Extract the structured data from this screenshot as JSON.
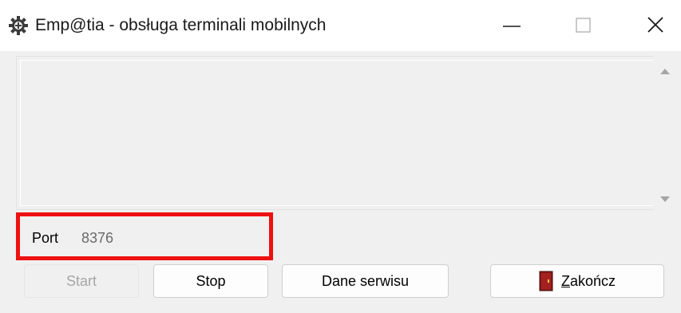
{
  "window": {
    "title": "Emp@tia - obsługa terminali mobilnych",
    "icon": "gear-icon",
    "controls": [
      "minimize-icon",
      "maximize-icon",
      "close-icon"
    ]
  },
  "log": {
    "content": ""
  },
  "port": {
    "label": "Port",
    "value": "8376"
  },
  "buttons": {
    "start": "Start",
    "stop": "Stop",
    "dane": "Dane serwisu",
    "zakoncz_mnemonic": "Z",
    "zakoncz_rest": "akończ"
  },
  "colors": {
    "highlight": "#ee1111",
    "door": "#8b1a1a"
  }
}
